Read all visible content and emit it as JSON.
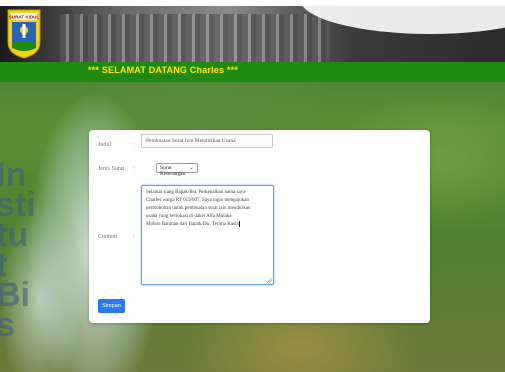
{
  "header": {
    "logo_text": "SURAT KIDUL",
    "welcome": "*** SELAMAT DATANG Charles ***"
  },
  "watermark": "Institut Bis",
  "form": {
    "judul": {
      "label": "Judul",
      "colon": ":",
      "value": "Pembuatan Surat Izin Mendirikan Usaha"
    },
    "jenis_surat": {
      "label": "Jenis Surat",
      "colon": ":",
      "selected": "Surat Keterangan",
      "chevron_icon": "chevron-down-icon"
    },
    "content": {
      "label": "Content",
      "colon": ":",
      "lines": [
        "Selamat siang Bapak/Ibu. Perkenalkan nama saya",
        "Charles warga RT 019/007. Saya ingin mengajukan",
        "permohonan untuk pembuatan surat izin mendirikan",
        "usaha yang berlokasi di daket Alfa Mulaka",
        "Mohon Bantuan dari Bapak/Ibu. Terima Kasih"
      ]
    },
    "submit_label": "Simpan"
  },
  "colors": {
    "welcome_bar": "#1f8a10",
    "welcome_text": "#ffe600",
    "button": "#2a7bf3"
  }
}
